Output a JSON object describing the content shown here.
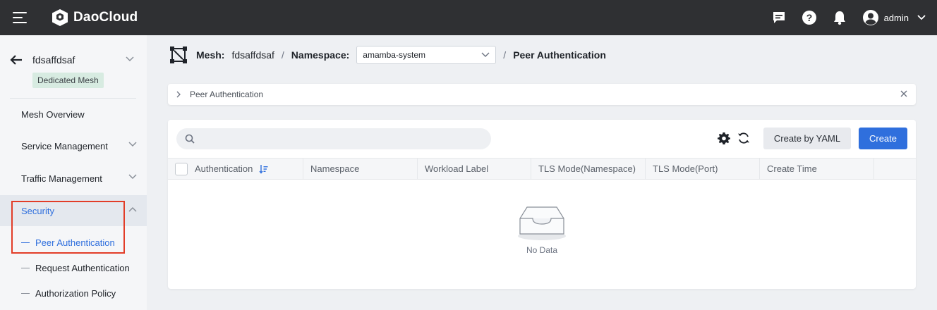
{
  "app": {
    "brand": "DaoCloud"
  },
  "topbar": {
    "username": "admin",
    "icons": [
      "menu-icon",
      "message-icon",
      "help-icon",
      "bell-icon",
      "user-icon",
      "chevron-down-icon"
    ]
  },
  "sidebar": {
    "mesh_name": "fdsaffdsaf",
    "mesh_badge": "Dedicated Mesh",
    "items": [
      {
        "label": "Mesh Overview"
      },
      {
        "label": "Service Management"
      },
      {
        "label": "Traffic Management"
      },
      {
        "label": "Security"
      }
    ],
    "security_sub": [
      {
        "label": "Peer Authentication"
      },
      {
        "label": "Request Authentication"
      },
      {
        "label": "Authorization Policy"
      }
    ]
  },
  "breadcrumb": {
    "mesh_label": "Mesh:",
    "mesh_value": "fdsaffdsaf",
    "sep": "/",
    "namespace_label": "Namespace:",
    "namespace_value": "amamba-system",
    "page": "Peer Authentication"
  },
  "infobar": {
    "text": "Peer Authentication"
  },
  "toolbar": {
    "search_placeholder": "",
    "yaml_button": "Create by YAML",
    "create_button": "Create"
  },
  "table": {
    "columns": [
      "Authentication",
      "Namespace",
      "Workload Label",
      "TLS Mode(Namespace)",
      "TLS Mode(Port)",
      "Create Time"
    ],
    "empty_text": "No Data"
  },
  "colors": {
    "accent": "#2f6fdd",
    "topbar": "#2f3033",
    "highlight": "#e23d28",
    "badge_bg": "#d7ebe1"
  }
}
